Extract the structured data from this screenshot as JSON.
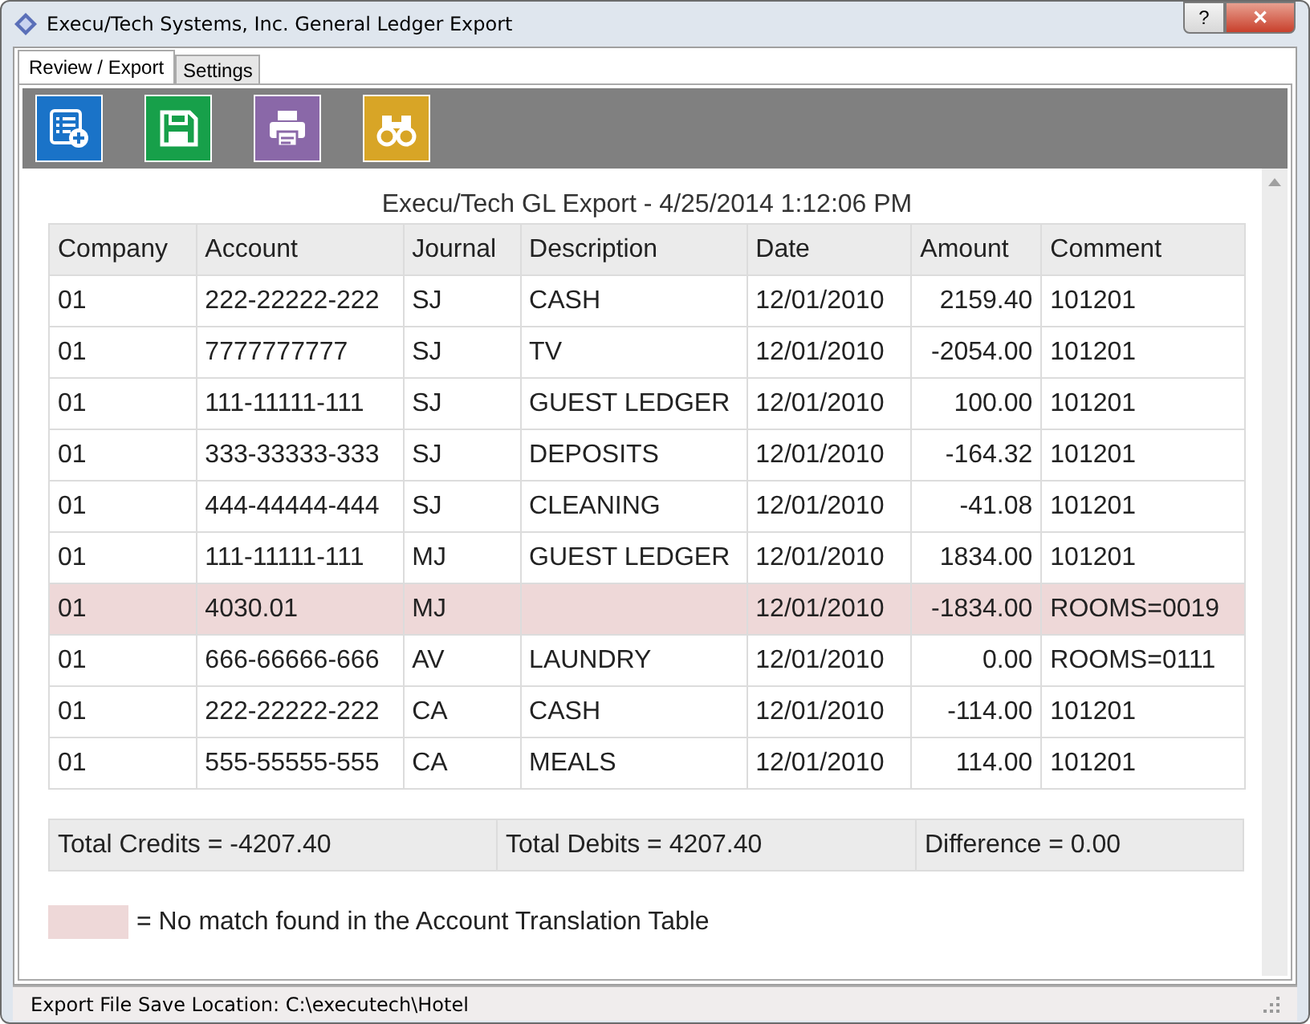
{
  "window": {
    "title": "Execu/Tech Systems, Inc. General Ledger Export",
    "help_button": "?",
    "close_button": "✕"
  },
  "tabs": [
    {
      "label": "Review / Export",
      "selected": true
    },
    {
      "label": "Settings",
      "selected": false
    }
  ],
  "toolbar": [
    {
      "kind": "new"
    },
    {
      "kind": "save"
    },
    {
      "kind": "print"
    },
    {
      "kind": "find"
    }
  ],
  "report": {
    "title": "Execu/Tech GL Export - 4/25/2014 1:12:06 PM",
    "columns": [
      "Company",
      "Account",
      "Journal",
      "Description",
      "Date",
      "Amount",
      "Comment"
    ],
    "rows": [
      {
        "cells": [
          "01",
          "222-22222-222",
          "SJ",
          "CASH",
          "12/01/2010",
          "2159.40",
          "101201"
        ],
        "unmatched": false
      },
      {
        "cells": [
          "01",
          "7777777777",
          "SJ",
          "TV",
          "12/01/2010",
          "-2054.00",
          "101201"
        ],
        "unmatched": false
      },
      {
        "cells": [
          "01",
          "111-11111-111",
          "SJ",
          "GUEST LEDGER",
          "12/01/2010",
          "100.00",
          "101201"
        ],
        "unmatched": false
      },
      {
        "cells": [
          "01",
          "333-33333-333",
          "SJ",
          "DEPOSITS",
          "12/01/2010",
          "-164.32",
          "101201"
        ],
        "unmatched": false
      },
      {
        "cells": [
          "01",
          "444-44444-444",
          "SJ",
          "CLEANING",
          "12/01/2010",
          "-41.08",
          "101201"
        ],
        "unmatched": false
      },
      {
        "cells": [
          "01",
          "111-11111-111",
          "MJ",
          "GUEST LEDGER",
          "12/01/2010",
          "1834.00",
          "101201"
        ],
        "unmatched": false
      },
      {
        "cells": [
          "01",
          "4030.01",
          "MJ",
          "",
          "12/01/2010",
          "-1834.00",
          "ROOMS=0019"
        ],
        "unmatched": true
      },
      {
        "cells": [
          "01",
          "666-66666-666",
          "AV",
          "LAUNDRY",
          "12/01/2010",
          "0.00",
          "ROOMS=0111"
        ],
        "unmatched": false
      },
      {
        "cells": [
          "01",
          "222-22222-222",
          "CA",
          "CASH",
          "12/01/2010",
          "-114.00",
          "101201"
        ],
        "unmatched": false
      },
      {
        "cells": [
          "01",
          "555-55555-555",
          "CA",
          "MEALS",
          "12/01/2010",
          "114.00",
          "101201"
        ],
        "unmatched": false
      }
    ],
    "totals": [
      "Total Credits = -4207.40",
      "Total Debits = 4207.40",
      "Difference = 0.00"
    ],
    "legend": "= No match found in the Account Translation Table"
  },
  "status_bar": "Export File Save Location: C:\\executech\\Hotel"
}
